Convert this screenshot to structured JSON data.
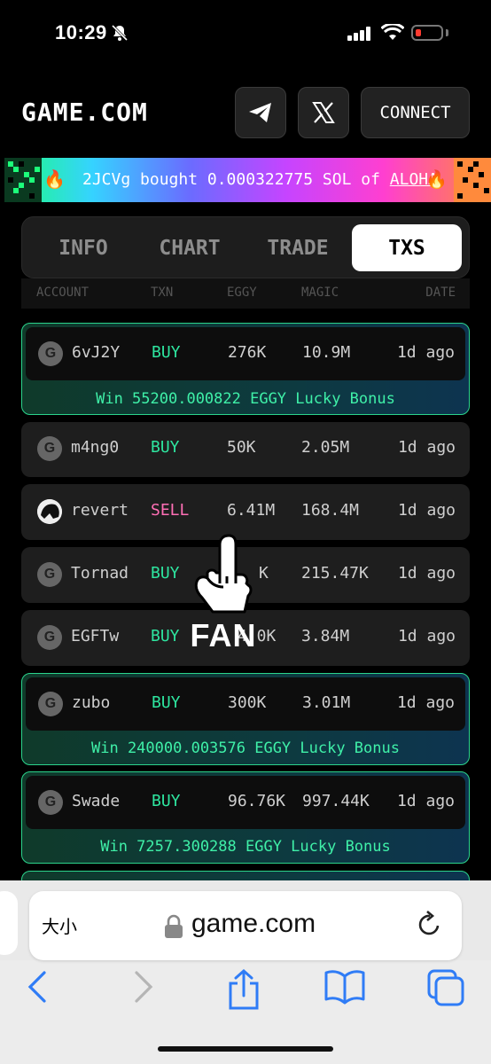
{
  "status_bar": {
    "time": "10:29"
  },
  "header": {
    "logo": "GAME.COM",
    "connect_label": "CONNECT"
  },
  "ticker": {
    "text": "2JCVg bought 0.000322775 SOL of ",
    "token": "ALOHA"
  },
  "tabs": [
    {
      "label": "INFO",
      "active": false
    },
    {
      "label": "CHART",
      "active": false
    },
    {
      "label": "TRADE",
      "active": false
    },
    {
      "label": "TXS",
      "active": true
    }
  ],
  "columns": [
    "ACCOUNT",
    "TXN",
    "EGGY",
    "MAGIC",
    "DATE"
  ],
  "rows": [
    {
      "account": "6vJ2Y",
      "txn": "BUY",
      "eggy": "276K",
      "magic": "10.9M",
      "date": "1d ago",
      "bonus": "Win 55200.000822 EGGY Lucky Bonus"
    },
    {
      "account": "m4ng0",
      "txn": "BUY",
      "eggy": "50K",
      "magic": "2.05M",
      "date": "1d ago"
    },
    {
      "account": "revert",
      "txn": "SELL",
      "eggy": "6.41M",
      "magic": "168.4M",
      "date": "1d ago"
    },
    {
      "account": "Tornad",
      "txn": "BUY",
      "eggy": "K",
      "magic": "215.47K",
      "date": "1d ago"
    },
    {
      "account": "EGFTw",
      "txn": "BUY",
      "eggy": "4 0K",
      "magic": "3.84M",
      "date": "1d ago"
    },
    {
      "account": "zubo",
      "txn": "BUY",
      "eggy": "300K",
      "magic": "3.01M",
      "date": "1d ago",
      "bonus": "Win 240000.003576 EGGY Lucky Bonus"
    },
    {
      "account": "Swade",
      "txn": "BUY",
      "eggy": "96.76K",
      "magic": "997.44K",
      "date": "1d ago",
      "bonus": "Win 7257.300288 EGGY Lucky Bonus"
    }
  ],
  "overlay": {
    "text": "FAN"
  },
  "browser": {
    "text_size_label": "大小",
    "url": "game.com"
  },
  "colors": {
    "buy": "#2ee6a0",
    "sell": "#ff6fb5",
    "bonus": "#3ff0a8"
  }
}
